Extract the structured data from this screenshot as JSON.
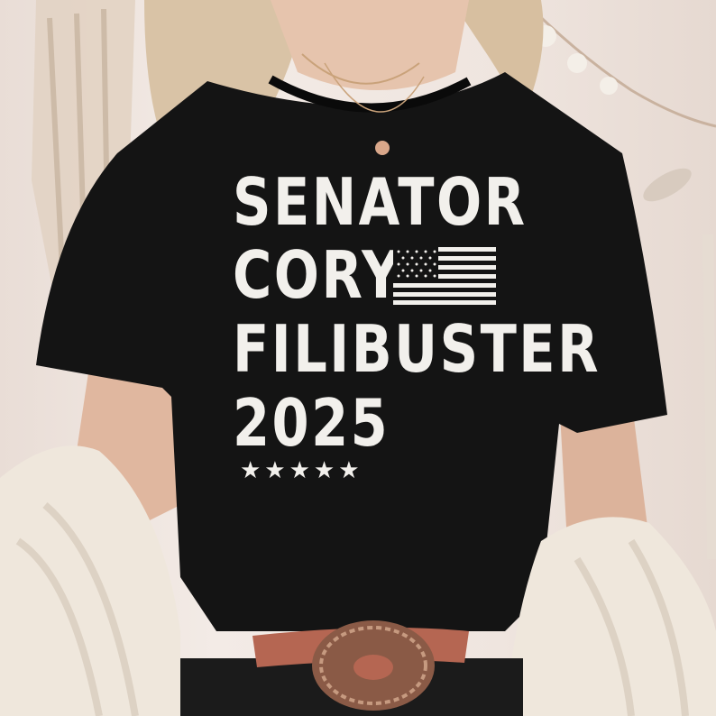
{
  "shirt_print": {
    "line1": "SENATOR",
    "line2": "CORY",
    "line3": "FILIBUSTER",
    "line4": "2025",
    "stars": "★★★★★"
  },
  "colors": {
    "shirt": "#141414",
    "print": "#f2f0ec",
    "background": "#efe6e1",
    "cardigan": "#efe7dc",
    "belt": "#b56652",
    "buckle": "#8a5a46"
  },
  "icons": [
    "american-flag-icon",
    "star-icon"
  ]
}
